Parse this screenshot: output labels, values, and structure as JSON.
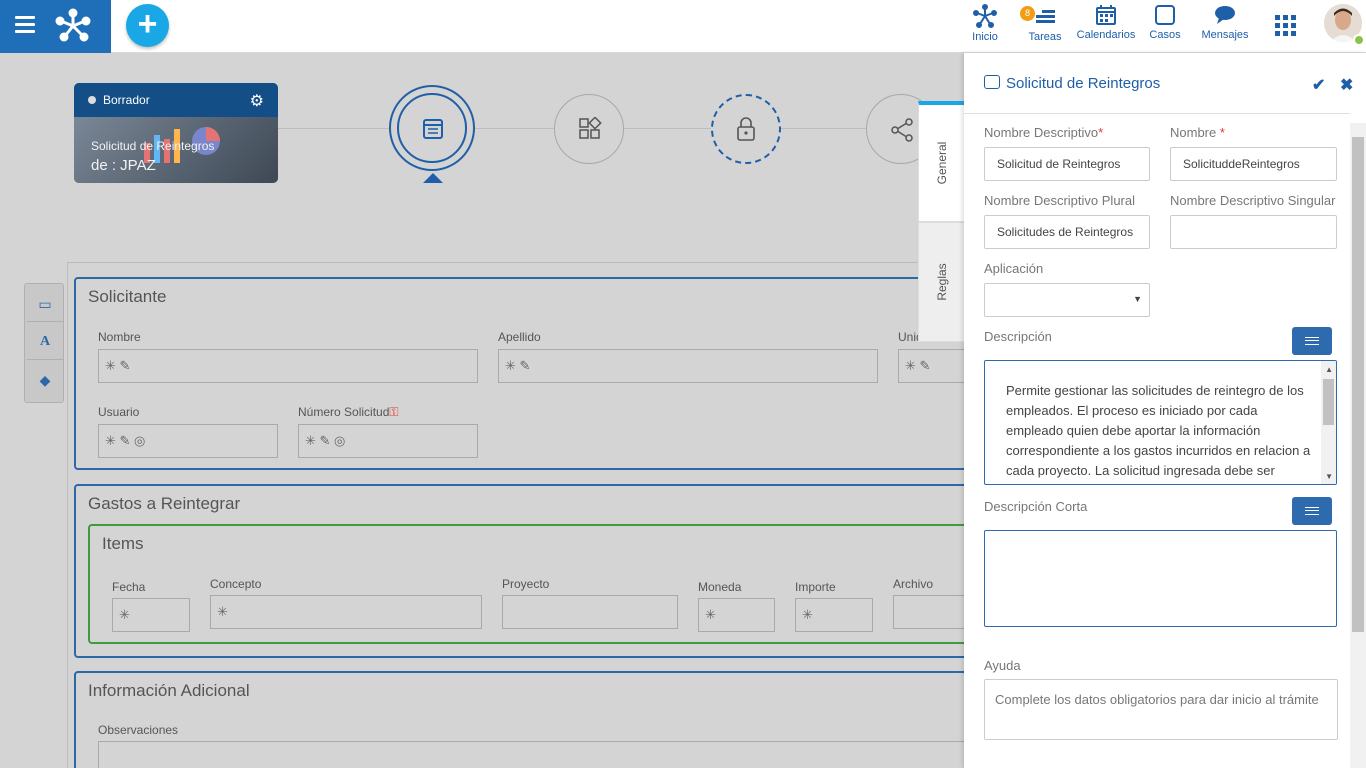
{
  "topbar": {
    "nav": [
      {
        "label": "Inicio",
        "icon": "process-icon"
      },
      {
        "label": "Tareas",
        "icon": "tasks-icon",
        "badge": "8"
      },
      {
        "label": "Calendarios",
        "icon": "calendar-icon"
      },
      {
        "label": "Casos",
        "icon": "cases-icon"
      },
      {
        "label": "Mensajes",
        "icon": "chat-icon"
      }
    ]
  },
  "process": {
    "status": "Borrador",
    "title": "Solicitud de Reintegros",
    "author": "de : JPAZ"
  },
  "form": {
    "solicitante": {
      "title": "Solicitante",
      "nombre": "Nombre",
      "apellido": "Apellido",
      "unidad": "Unid",
      "usuario": "Usuario",
      "numero": "Número Solicitud"
    },
    "gastos": {
      "title": "Gastos a Reintegrar",
      "items_title": "Items",
      "fecha": "Fecha",
      "concepto": "Concepto",
      "proyecto": "Proyecto",
      "moneda": "Moneda",
      "importe": "Importe",
      "archivo": "Archivo"
    },
    "info": {
      "title": "Información Adicional",
      "observaciones": "Observaciones"
    }
  },
  "tabs": {
    "general": "General",
    "reglas": "Reglas"
  },
  "panel": {
    "title": "Solicitud de Reintegros",
    "nombre_descriptivo_label": "Nombre Descriptivo",
    "nombre_descriptivo_value": "Solicitud de Reintegros",
    "nombre_label": "Nombre",
    "nombre_value": "SolicituddeReintegros",
    "plural_label": "Nombre Descriptivo Plural",
    "plural_value": "Solicitudes de Reintegros",
    "singular_label": "Nombre Descriptivo Singular",
    "singular_value": "",
    "aplicacion_label": "Aplicación",
    "aplicacion_value": "",
    "descripcion_label": "Descripción",
    "descripcion_value": "Permite gestionar las solicitudes de reintegro de los empleados. El proceso es iniciado por cada empleado quien debe aportar la información correspondiente a los gastos incurridos en relacion a cada proyecto. La solicitud ingresada debe ser",
    "descripcion_corta_label": "Descripción Corta",
    "descripcion_corta_value": "",
    "ayuda_label": "Ayuda",
    "ayuda_value": "Complete los datos obligatorios para dar inicio al trámite"
  },
  "colors": {
    "brand": "#1e6fb8",
    "accent": "#1aa7e6",
    "required": "#e53935"
  }
}
